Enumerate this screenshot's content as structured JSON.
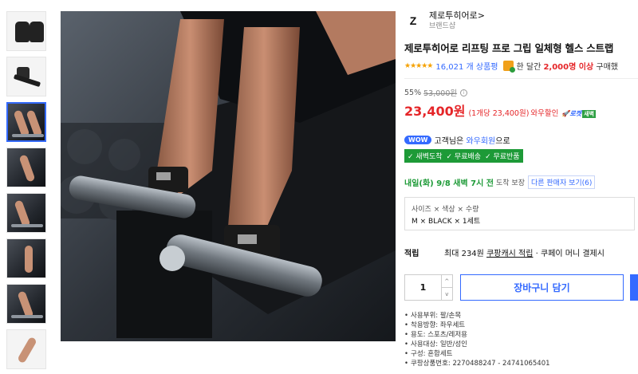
{
  "brand": {
    "logo_text": "Z",
    "name": "제로투히어로",
    "chevron": ">",
    "subtitle": "브랜드샵"
  },
  "product": {
    "title": "제로투히어로 리프팅 프로 그립 일체형 헬스 스트랩",
    "stars": "★★★★★",
    "review_count": "16,021 개 상품평",
    "sales_prefix": "한 달간",
    "sales_count": "2,000명 이상",
    "sales_suffix": "구매했"
  },
  "price": {
    "discount_rate": "55%",
    "original": "53,000원",
    "info_icon": "i",
    "sale": "23,400원",
    "unit": "(1개당 23,400원)",
    "wow_sale": "와우할인",
    "rocket": "🚀로켓",
    "rocket_badge": "새벽"
  },
  "wow": {
    "badge": "WOW",
    "text_prefix": "고객님은",
    "member": "와우회원",
    "text_suffix": "으로"
  },
  "benefits": [
    "✓ 새벽도착",
    "✓ 무료배송",
    "✓ 무료반품"
  ],
  "delivery": {
    "date": "내일(화) 9/8 새벽 7시 전",
    "guarantee": "도착 보장",
    "other_sellers": "다른 판매자 보기(6)"
  },
  "option": {
    "label": "사이즈 × 색상 × 수량",
    "value": "M × BLACK × 1세트"
  },
  "reward": {
    "label": "적립",
    "prefix": "최대 234원",
    "cash": "쿠팡캐시 적립",
    "suffix": "· 쿠페이 머니 결제시"
  },
  "purchase": {
    "quantity": "1",
    "up": "^",
    "down": "v",
    "cart_label": "장바구니 담기"
  },
  "attributes": [
    "사용부위: 팔/손목",
    "착용방향: 좌우세트",
    "용도: 스포츠/레저용",
    "사용대상: 일반/성인",
    "구성: 혼합세트",
    "쿠팡상품번호: 2270488247 - 24741065401"
  ],
  "colors": {
    "accent": "#346aff",
    "price_red": "#e52528",
    "green": "#1d9a37",
    "star": "#f5a100"
  }
}
